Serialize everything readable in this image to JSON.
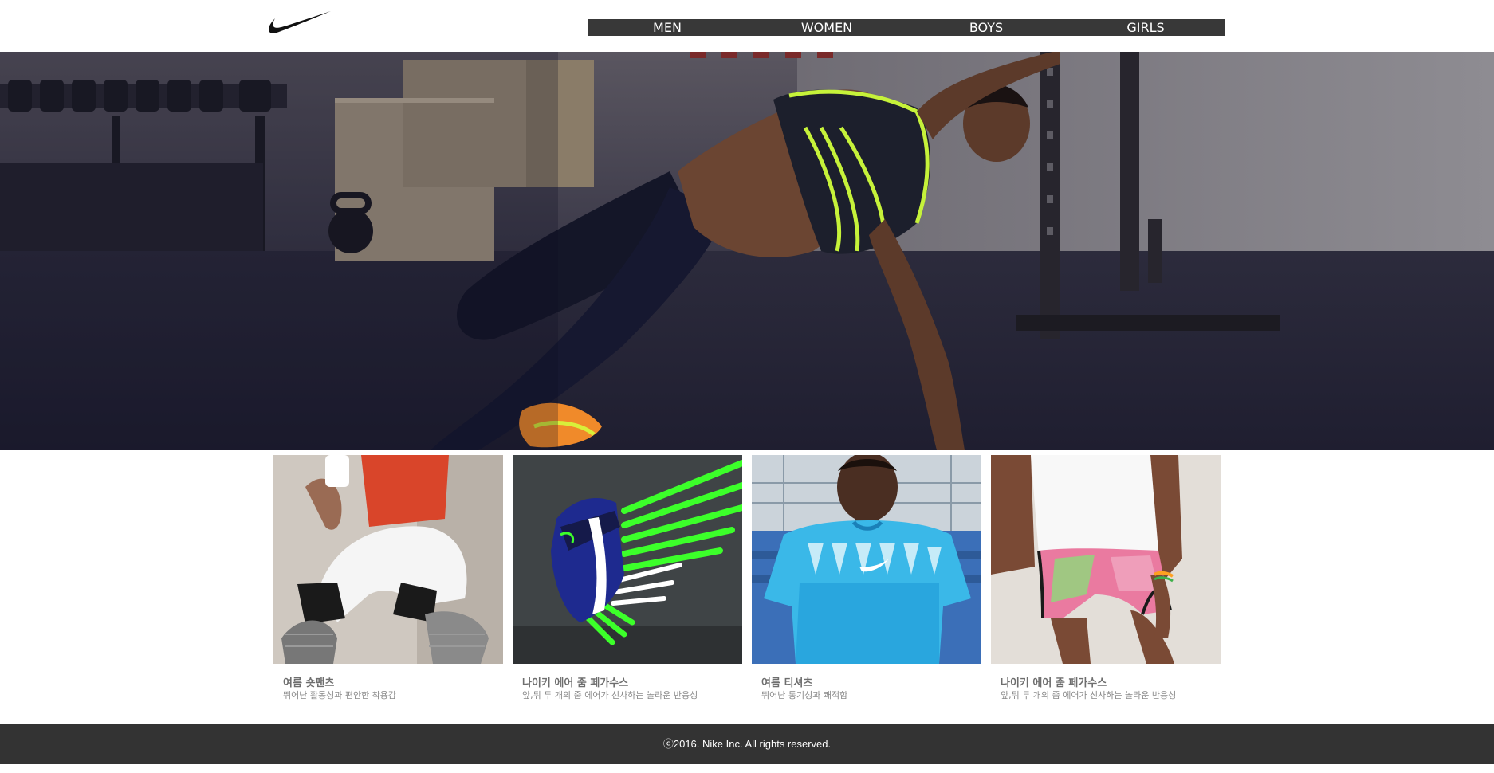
{
  "brand": {
    "logo_icon": "swoosh-icon",
    "logo_color": "#111111"
  },
  "nav": {
    "background": "#383838",
    "items": [
      {
        "label": "MEN"
      },
      {
        "label": "WOMEN"
      },
      {
        "label": "BOYS"
      },
      {
        "label": "GIRLS"
      }
    ]
  },
  "hero": {
    "image": "athlete-side-plank-photo"
  },
  "products": [
    {
      "name": "여름 숏팬츠",
      "desc": "뛰어난 활동성과 편안한 착용감",
      "image": "shorts-photo"
    },
    {
      "name": "나이키 에어 줌 페가수스",
      "desc": "앞,뒤 두 개의 줌 에어가 선사하는 놀라운 반응성",
      "image": "running-shoe-photo"
    },
    {
      "name": "여름 티셔츠",
      "desc": "뛰어난 통기성과 쾌적함",
      "image": "tshirt-photo"
    },
    {
      "name": "나이키 에어 줌 페가수스",
      "desc": "앞,뒤 두 개의 줌 에어가 선사하는 놀라운 반응성",
      "image": "girls-shorts-photo"
    }
  ],
  "footer": {
    "copyright": "ⓒ2016. Nike Inc. All rights reserved.",
    "background": "#333333"
  }
}
